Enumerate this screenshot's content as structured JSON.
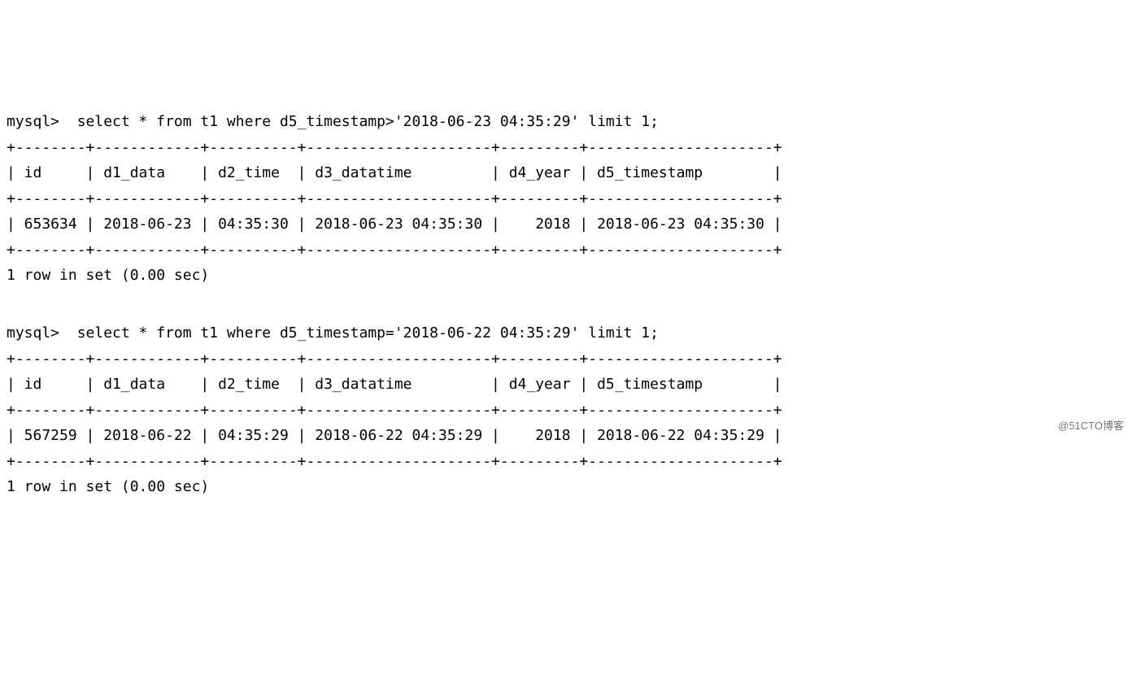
{
  "watermark": "@51CTO博客",
  "blocks": [
    {
      "prompt": "mysql> ",
      "query": " select * from t1 where d5_timestamp>'2018-06-23 04:35:29' limit 1;",
      "sep": "+--------+------------+----------+---------------------+---------+---------------------+",
      "header": "| id     | d1_data    | d2_time  | d3_datatime         | d4_year | d5_timestamp        |",
      "rows": [
        "| 653634 | 2018-06-23 | 04:35:30 | 2018-06-23 04:35:30 |    2018 | 2018-06-23 04:35:30 |"
      ],
      "footer": "1 row in set (0.00 sec)"
    },
    {
      "prompt": "mysql> ",
      "query": " select * from t1 where d5_timestamp='2018-06-22 04:35:29' limit 1;",
      "sep": "+--------+------------+----------+---------------------+---------+---------------------+",
      "header": "| id     | d1_data    | d2_time  | d3_datatime         | d4_year | d5_timestamp        |",
      "rows": [
        "| 567259 | 2018-06-22 | 04:35:29 | 2018-06-22 04:35:29 |    2018 | 2018-06-22 04:35:29 |"
      ],
      "footer": "1 row in set (0.00 sec)"
    }
  ]
}
